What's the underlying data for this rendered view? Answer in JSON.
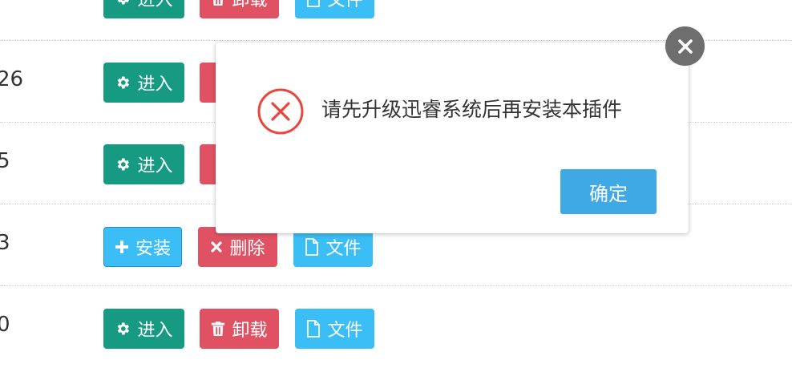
{
  "rows": [
    {
      "num": "",
      "actions": [
        "进入",
        "卸载",
        "文件"
      ]
    },
    {
      "num": "26",
      "actions": [
        "进入"
      ]
    },
    {
      "num": "5",
      "actions": [
        "进入"
      ]
    },
    {
      "num": "3",
      "actions": [
        "安装",
        "删除",
        "文件"
      ]
    },
    {
      "num": "0",
      "actions": [
        "进入",
        "卸载",
        "文件"
      ]
    }
  ],
  "dialog": {
    "message": "请先升级迅睿系统后再安装本插件",
    "confirm_label": "确定",
    "icon": "error-circle-icon"
  },
  "colors": {
    "enter": "#169b82",
    "uninstall": "#e05263",
    "file": "#3bbef6",
    "confirm": "#3fa9e6",
    "error": "#e8463c"
  }
}
